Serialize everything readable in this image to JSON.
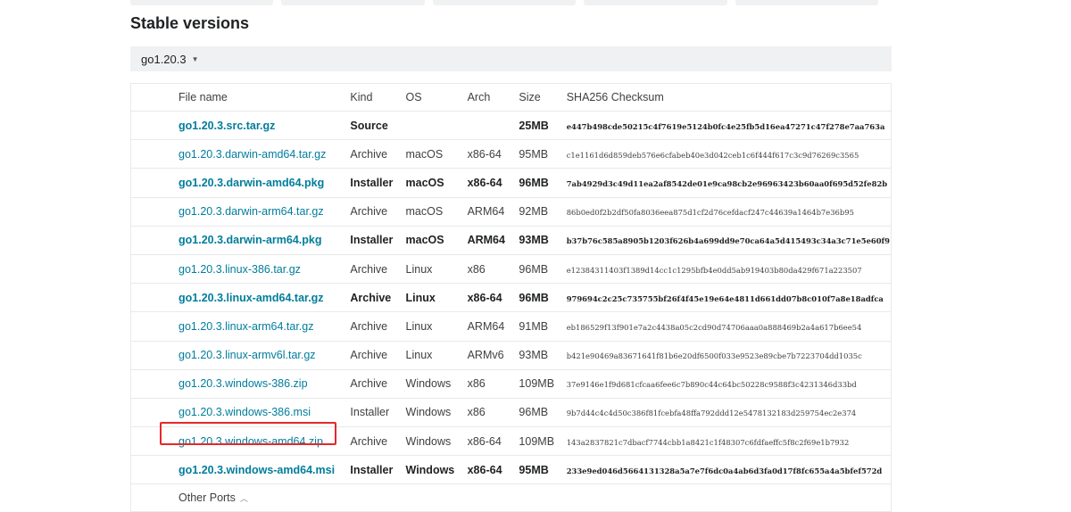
{
  "section": {
    "title": "Stable versions"
  },
  "version_selector": {
    "selected": "go1.20.3"
  },
  "columns": {
    "file": "File name",
    "kind": "Kind",
    "os": "OS",
    "arch": "Arch",
    "size": "Size",
    "checksum": "SHA256 Checksum"
  },
  "rows": [
    {
      "file": "go1.20.3.src.tar.gz",
      "kind": "Source",
      "os": "",
      "arch": "",
      "size": "25MB",
      "checksum": "e447b498cde50215c4f7619e5124b0fc4e25fb5d16ea47271c47f278e7aa763a",
      "highlight": true
    },
    {
      "file": "go1.20.3.darwin-amd64.tar.gz",
      "kind": "Archive",
      "os": "macOS",
      "arch": "x86-64",
      "size": "95MB",
      "checksum": "c1e1161d6d859deb576e6cfabeb40e3d042ceb1c6f444f617c3c9d76269c3565",
      "highlight": false
    },
    {
      "file": "go1.20.3.darwin-amd64.pkg",
      "kind": "Installer",
      "os": "macOS",
      "arch": "x86-64",
      "size": "96MB",
      "checksum": "7ab4929d3c49d11ea2af8542de01e9ca98cb2e96963423b60aa0f695d52fe82b",
      "highlight": true
    },
    {
      "file": "go1.20.3.darwin-arm64.tar.gz",
      "kind": "Archive",
      "os": "macOS",
      "arch": "ARM64",
      "size": "92MB",
      "checksum": "86b0ed0f2b2df50fa8036eea875d1cf2d76cefdacf247c44639a1464b7e36b95",
      "highlight": false
    },
    {
      "file": "go1.20.3.darwin-arm64.pkg",
      "kind": "Installer",
      "os": "macOS",
      "arch": "ARM64",
      "size": "93MB",
      "checksum": "b37b76c585a8905b1203f626b4a699dd9e70ca64a5d415493c34a3c71e5e60f9",
      "highlight": true
    },
    {
      "file": "go1.20.3.linux-386.tar.gz",
      "kind": "Archive",
      "os": "Linux",
      "arch": "x86",
      "size": "96MB",
      "checksum": "e12384311403f1389d14cc1c1295bfb4e0dd5ab919403b80da429f671a223507",
      "highlight": false
    },
    {
      "file": "go1.20.3.linux-amd64.tar.gz",
      "kind": "Archive",
      "os": "Linux",
      "arch": "x86-64",
      "size": "96MB",
      "checksum": "979694c2c25c735755bf26f4f45e19e64e4811d661dd07b8c010f7a8e18adfca",
      "highlight": true
    },
    {
      "file": "go1.20.3.linux-arm64.tar.gz",
      "kind": "Archive",
      "os": "Linux",
      "arch": "ARM64",
      "size": "91MB",
      "checksum": "eb186529f13f901e7a2c4438a05c2cd90d74706aaa0a888469b2a4a617b6ee54",
      "highlight": false
    },
    {
      "file": "go1.20.3.linux-armv6l.tar.gz",
      "kind": "Archive",
      "os": "Linux",
      "arch": "ARMv6",
      "size": "93MB",
      "checksum": "b421e90469a83671641f81b6e20df6500f033e9523e89cbe7b7223704dd1035c",
      "highlight": false
    },
    {
      "file": "go1.20.3.windows-386.zip",
      "kind": "Archive",
      "os": "Windows",
      "arch": "x86",
      "size": "109MB",
      "checksum": "37e9146e1f9d681cfcaa6fee6c7b890c44c64bc50228c9588f3c4231346d33bd",
      "highlight": false
    },
    {
      "file": "go1.20.3.windows-386.msi",
      "kind": "Installer",
      "os": "Windows",
      "arch": "x86",
      "size": "96MB",
      "checksum": "9b7d44c4c4d50c386f81fcebfa48ffa792ddd12e5478132183d259754ec2e374",
      "highlight": false
    },
    {
      "file": "go1.20.3.windows-amd64.zip",
      "kind": "Archive",
      "os": "Windows",
      "arch": "x86-64",
      "size": "109MB",
      "checksum": "143a2837821c7dbacf7744cbb1a8421c1f48307c6fdfaeffc5f8c2f69e1b7932",
      "highlight": false
    },
    {
      "file": "go1.20.3.windows-amd64.msi",
      "kind": "Installer",
      "os": "Windows",
      "arch": "x86-64",
      "size": "95MB",
      "checksum": "233e9ed046d5664131328a5a7e7f6dc0a4ab6d3fa0d17f8fc655a4a5bfef572d",
      "highlight": true
    }
  ],
  "other_ports": {
    "label": "Other Ports"
  },
  "colors": {
    "link": "#007d9c",
    "selection_outline": "#e5282b",
    "toggle_bg": "#f0f1f2"
  }
}
